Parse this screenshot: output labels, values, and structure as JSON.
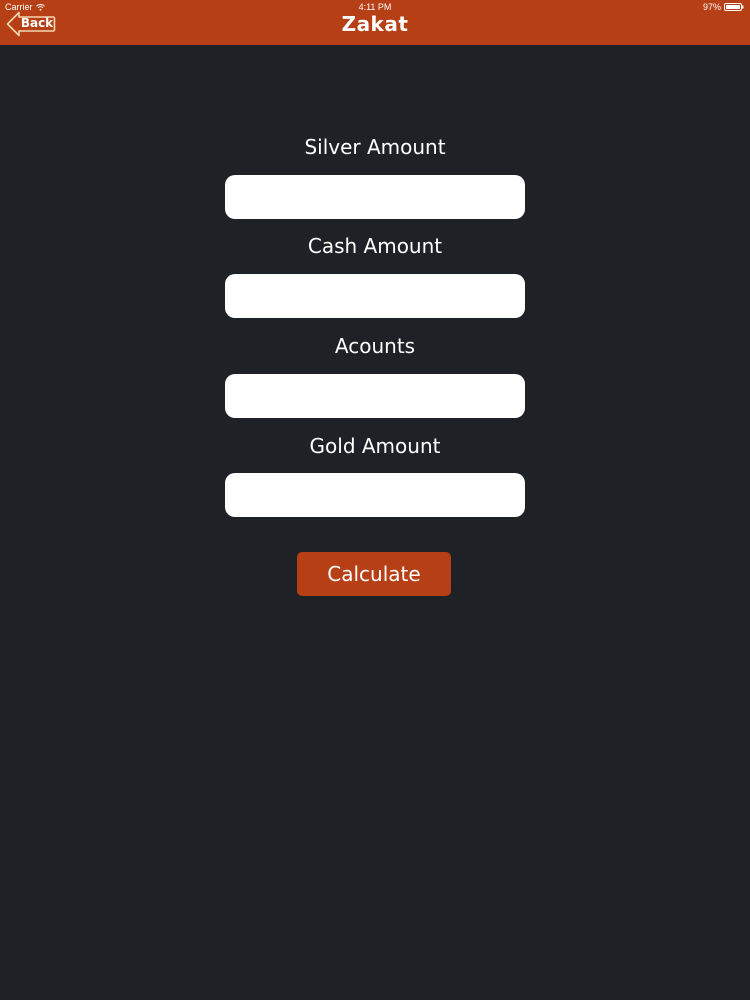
{
  "status_bar": {
    "carrier": "Carrier",
    "time": "4:11 PM",
    "battery": "97%",
    "wifi_icon": "wifi-icon",
    "battery_icon": "battery-icon"
  },
  "nav": {
    "back_label": "Back",
    "title": "Zakat",
    "bar_color": "#b63f16"
  },
  "form": {
    "fields": [
      {
        "label": "Silver Amount",
        "value": "",
        "placeholder": ""
      },
      {
        "label": "Cash Amount",
        "value": "",
        "placeholder": ""
      },
      {
        "label": "Acounts",
        "value": "",
        "placeholder": ""
      },
      {
        "label": "Gold Amount",
        "value": "",
        "placeholder": ""
      }
    ],
    "calculate_label": "Calculate"
  },
  "colors": {
    "background": "#1e2226",
    "accent": "#b63f16",
    "input_background": "#ffffff"
  }
}
